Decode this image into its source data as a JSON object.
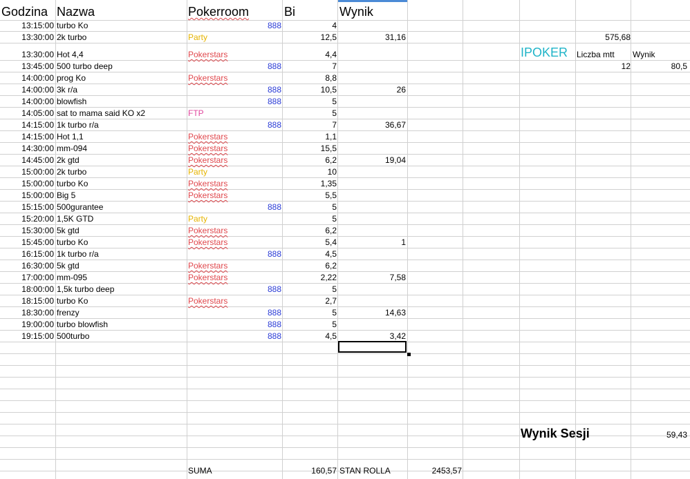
{
  "headers": {
    "godzina": "Godzina",
    "nazwa": "Nazwa",
    "pokerroom": "Pokerroom",
    "bi": "Bi",
    "wynik": "Wynik"
  },
  "rows": [
    {
      "time": "13:15:00",
      "name": "turbo Ko",
      "room": "888",
      "bi": "4",
      "result": ""
    },
    {
      "time": "13:30:00",
      "name": "2k turbo",
      "room": "Party",
      "bi": "12,5",
      "result": "31,16"
    },
    {
      "time": "13:30:00",
      "name": "Hot 4,4",
      "room": "Pokerstars",
      "bi": "4,4",
      "result": ""
    },
    {
      "time": "13:45:00",
      "name": "500 turbo deep",
      "room": "888",
      "bi": "7",
      "result": ""
    },
    {
      "time": "14:00:00",
      "name": "prog Ko",
      "room": "Pokerstars",
      "bi": "8,8",
      "result": ""
    },
    {
      "time": "14:00:00",
      "name": "3k r/a",
      "room": "888",
      "bi": "10,5",
      "result": "26"
    },
    {
      "time": "14:00:00",
      "name": "blowfish",
      "room": "888",
      "bi": "5",
      "result": ""
    },
    {
      "time": "14:05:00",
      "name": "sat to mama said KO x2",
      "room": "FTP",
      "bi": "5",
      "result": ""
    },
    {
      "time": "14:15:00",
      "name": "1k turbo r/a",
      "room": "888",
      "bi": "7",
      "result": "36,67"
    },
    {
      "time": "14:15:00",
      "name": "Hot 1,1",
      "room": "Pokerstars",
      "bi": "1,1",
      "result": ""
    },
    {
      "time": "14:30:00",
      "name": "mm-094",
      "room": "Pokerstars",
      "bi": "15,5",
      "result": ""
    },
    {
      "time": "14:45:00",
      "name": "2k gtd",
      "room": "Pokerstars",
      "bi": "6,2",
      "result": "19,04"
    },
    {
      "time": "15:00:00",
      "name": "2k turbo",
      "room": "Party",
      "bi": "10",
      "result": ""
    },
    {
      "time": "15:00:00",
      "name": "turbo Ko",
      "room": "Pokerstars",
      "bi": "1,35",
      "result": ""
    },
    {
      "time": "15:00:00",
      "name": "Big 5",
      "room": "Pokerstars",
      "bi": "5,5",
      "result": ""
    },
    {
      "time": "15:15:00",
      "name": "500gurantee",
      "room": "888",
      "bi": "5",
      "result": ""
    },
    {
      "time": "15:20:00",
      "name": "1,5K GTD",
      "room": "Party",
      "bi": "5",
      "result": ""
    },
    {
      "time": "15:30:00",
      "name": "5k gtd",
      "room": "Pokerstars",
      "bi": "6,2",
      "result": ""
    },
    {
      "time": "15:45:00",
      "name": "turbo Ko",
      "room": "Pokerstars",
      "bi": "5,4",
      "result": "1"
    },
    {
      "time": "16:15:00",
      "name": "1k turbo r/a",
      "room": "888",
      "bi": "4,5",
      "result": ""
    },
    {
      "time": "16:30:00",
      "name": "5k gtd",
      "room": "Pokerstars",
      "bi": "6,2",
      "result": ""
    },
    {
      "time": "17:00:00",
      "name": "mm-095",
      "room": "Pokerstars",
      "bi": "2,22",
      "result": "7,58"
    },
    {
      "time": "18:00:00",
      "name": "1,5k turbo deep",
      "room": "888",
      "bi": "5",
      "result": ""
    },
    {
      "time": "18:15:00",
      "name": "turbo Ko",
      "room": "Pokerstars",
      "bi": "2,7",
      "result": ""
    },
    {
      "time": "18:30:00",
      "name": "frenzy",
      "room": "888",
      "bi": "5",
      "result": "14,63"
    },
    {
      "time": "19:00:00",
      "name": "turbo blowfish",
      "room": "888",
      "bi": "5",
      "result": ""
    },
    {
      "time": "19:15:00",
      "name": "500turbo",
      "room": "888",
      "bi": "4,5",
      "result": "3,42"
    }
  ],
  "side": {
    "total_value": "575,68",
    "ipoker": "IPOKER",
    "liczba_mtt_label": "Liczba mtt",
    "wynik_label": "Wynik",
    "liczba_mtt_value": "12",
    "wynik_value": "80,5",
    "wynik_sesji_label": "Wynik Sesji",
    "wynik_sesji_value": "59,43"
  },
  "footer": {
    "suma_label": "SUMA",
    "suma_value": "160,57",
    "stan_rolla_label": "STAN ROLLA",
    "stan_rolla_value": "2453,57"
  }
}
